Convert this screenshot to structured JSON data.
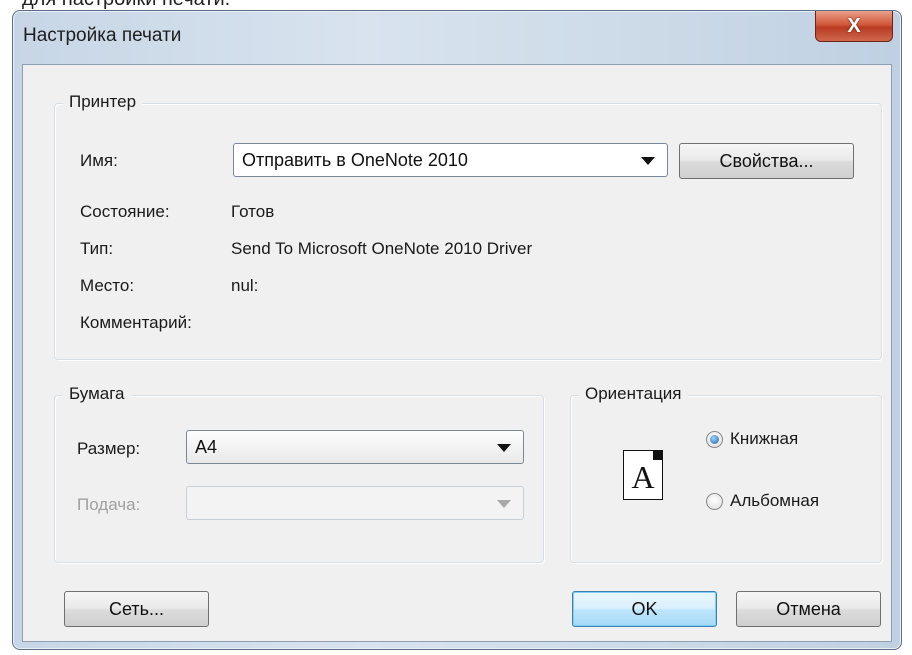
{
  "top_cut_text": "для настройки печати.",
  "window": {
    "title": "Настройка печати",
    "close_label": "X"
  },
  "printer": {
    "legend": "Принтер",
    "name_label": "Имя:",
    "name_value": "Отправить в OneNote 2010",
    "properties_button": "Свойства...",
    "status_label": "Состояние:",
    "status_value": "Готов",
    "type_label": "Тип:",
    "type_value": "Send To Microsoft OneNote 2010 Driver",
    "location_label": "Место:",
    "location_value": "nul:",
    "comment_label": "Комментарий:",
    "comment_value": ""
  },
  "paper": {
    "legend": "Бумага",
    "size_label": "Размер:",
    "size_value": "A4",
    "source_label": "Подача:",
    "source_value": ""
  },
  "orientation": {
    "legend": "Ориентация",
    "icon_letter": "A",
    "portrait_label": "Книжная",
    "landscape_label": "Альбомная",
    "selected": "portrait"
  },
  "buttons": {
    "network": "Сеть...",
    "ok": "OK",
    "cancel": "Отмена"
  }
}
